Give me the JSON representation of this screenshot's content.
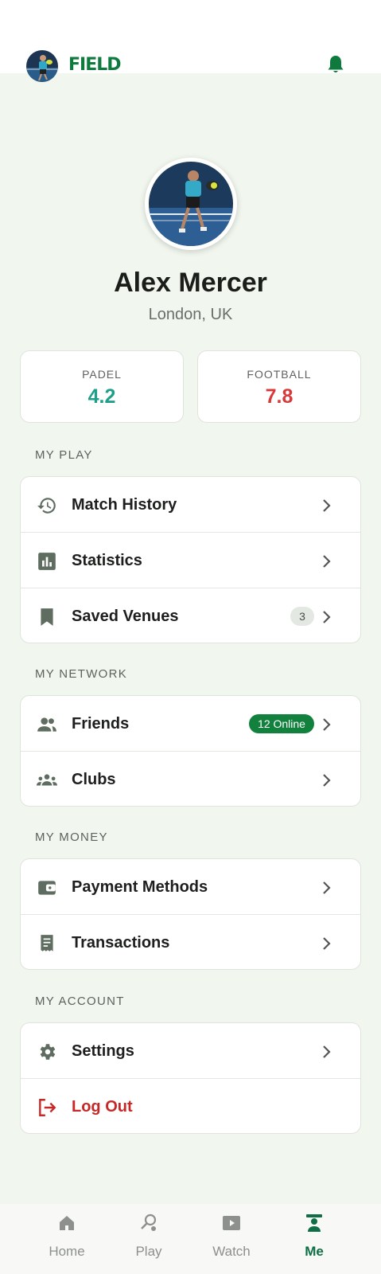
{
  "header": {
    "brand": "FIELD",
    "avatar": "user-avatar",
    "bell_icon": "bell-icon"
  },
  "profile": {
    "name": "Alex Mercer",
    "location": "London, UK"
  },
  "ratings": [
    {
      "sport": "PADEL",
      "rating": "4.2",
      "color": "#1f9e8a"
    },
    {
      "sport": "FOOTBALL",
      "rating": "7.8",
      "color": "#d83a3a"
    }
  ],
  "sections": {
    "my_play": {
      "title": "MY PLAY",
      "items": [
        {
          "label": "Match History",
          "icon": "history-icon"
        },
        {
          "label": "Statistics",
          "icon": "bar-chart-icon"
        },
        {
          "label": "Saved Venues",
          "icon": "bookmark-icon",
          "badge": "3"
        }
      ]
    },
    "my_network": {
      "title": "MY NETWORK",
      "items": [
        {
          "label": "Friends",
          "icon": "people-icon",
          "badge": "12 Online"
        },
        {
          "label": "Clubs",
          "icon": "groups-icon"
        }
      ]
    },
    "my_money": {
      "title": "MY MONEY",
      "items": [
        {
          "label": "Payment Methods",
          "icon": "wallet-icon"
        },
        {
          "label": "Transactions",
          "icon": "receipt-icon"
        }
      ]
    },
    "my_account": {
      "title": "MY ACCOUNT",
      "items": [
        {
          "label": "Settings",
          "icon": "gear-icon"
        },
        {
          "label": "Log Out",
          "icon": "logout-icon",
          "color": "#c62828"
        }
      ]
    }
  },
  "nav": {
    "items": [
      {
        "label": "Home",
        "icon": "home-icon"
      },
      {
        "label": "Play",
        "icon": "racket-icon"
      },
      {
        "label": "Watch",
        "icon": "play-video-icon"
      },
      {
        "label": "Me",
        "icon": "person-icon",
        "active": true
      }
    ]
  },
  "colors": {
    "brand": "#0f7a3e",
    "background": "#f1f7ee",
    "muted_icon": "#5f6d60"
  }
}
